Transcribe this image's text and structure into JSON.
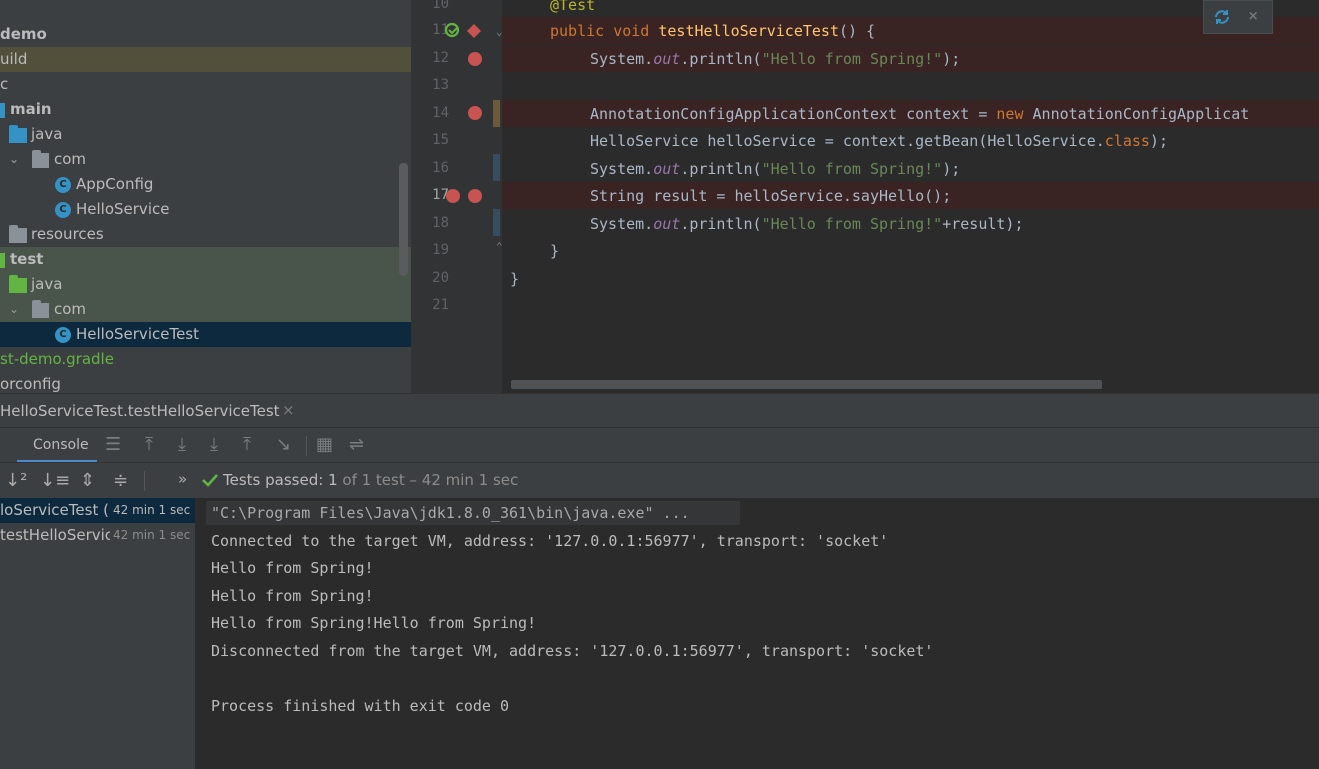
{
  "project_tree": {
    "items": [
      {
        "label": "demo"
      },
      {
        "label": "uild"
      },
      {
        "label": "c"
      },
      {
        "label": "main"
      },
      {
        "label": "java"
      },
      {
        "label": "com"
      },
      {
        "label": "AppConfig"
      },
      {
        "label": "HelloService"
      },
      {
        "label": "resources"
      },
      {
        "label": "test"
      },
      {
        "label": "java"
      },
      {
        "label": "com"
      },
      {
        "label": "HelloServiceTest"
      },
      {
        "label": "st-demo.gradle"
      },
      {
        "label": "orconfig"
      }
    ]
  },
  "editor": {
    "line_numbers": [
      "10",
      "11",
      "12",
      "13",
      "14",
      "15",
      "16",
      "17",
      "18",
      "19",
      "20",
      "21"
    ],
    "code": {
      "l10_annotation": "@Test",
      "l11_public": "public",
      "l11_void": "void",
      "l11_method": "testHelloServiceTest",
      "l11_rest": "() {",
      "l12_a": "System.",
      "l12_out": "out",
      "l12_b": ".println(",
      "l12_str": "\"Hello from Spring!\"",
      "l12_c": ");",
      "l14_a": "AnnotationConfigApplicationContext context = ",
      "l14_new": "new",
      "l14_b": " AnnotationConfigApplicat",
      "l15_a": "HelloService helloService = context.getBean(HelloService.",
      "l15_class": "class",
      "l15_b": ");",
      "l16_a": "System.",
      "l16_out": "out",
      "l16_b": ".println(",
      "l16_str": "\"Hello from Spring!\"",
      "l16_c": ");",
      "l17": "String result = helloService.sayHello();",
      "l18_a": "System.",
      "l18_out": "out",
      "l18_b": ".println(",
      "l18_str": "\"Hello from Spring!\"",
      "l18_c": "+result);",
      "l19": "}",
      "l20": "}"
    },
    "popup": {
      "refresh_icon": "refresh-icon",
      "close_icon": "close-icon",
      "close_glyph": "×"
    }
  },
  "run_panel": {
    "tab_label": "HelloServiceTest.testHelloServiceTest",
    "tab_close": "×",
    "console_tab": "Console",
    "status": {
      "prefix": "Tests passed:",
      "count": "1",
      "suffix": "of 1 test – 42 min 1 sec"
    },
    "tree": [
      {
        "label": "loServiceTest (",
        "time": "42 min 1 sec"
      },
      {
        "label": "testHelloServic",
        "time": "42 min 1 sec"
      }
    ],
    "console_lines": [
      "\"C:\\Program Files\\Java\\jdk1.8.0_361\\bin\\java.exe\" ...",
      "Connected to the target VM, address: '127.0.0.1:56977', transport: 'socket'",
      "Hello from Spring!",
      "Hello from Spring!",
      "Hello from Spring!Hello from Spring!",
      "Disconnected from the target VM, address: '127.0.0.1:56977', transport: 'socket'",
      "",
      "Process finished with exit code 0"
    ]
  },
  "colors": {
    "keyword": "#cc7832",
    "method": "#ffc66d",
    "string": "#6a8759",
    "field": "#9876aa",
    "breakpoint": "#c75450",
    "passed": "#62b543"
  }
}
